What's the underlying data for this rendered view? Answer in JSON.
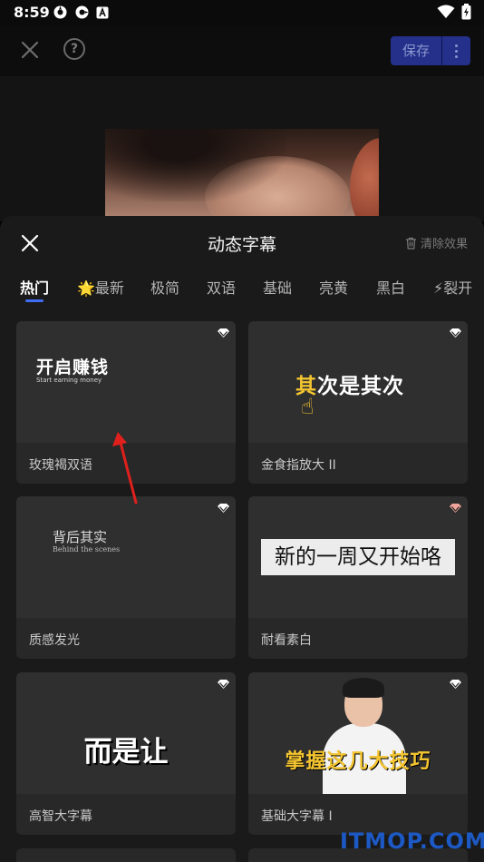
{
  "status": {
    "time": "8:59"
  },
  "topbar": {
    "save_label": "保存"
  },
  "sheet": {
    "title": "动态字幕",
    "clear_label": "清除效果",
    "tabs": [
      "热门",
      "🌟最新",
      "极简",
      "双语",
      "基础",
      "亮黄",
      "黑白",
      "⚡裂开"
    ]
  },
  "cards": [
    {
      "name": "玫瑰褐双语",
      "preview_cn": "开启赚钱",
      "preview_en": "Start earning money",
      "gem_color": "#ffffff"
    },
    {
      "name": "金食指放大 II",
      "preview_highlight": "其",
      "preview_rest": "次是其次",
      "gem_color": "#ffffff"
    },
    {
      "name": "质感发光",
      "preview_cn": "背后其实",
      "preview_en": "Behind the scenes",
      "gem_color": "#ffffff"
    },
    {
      "name": "耐看素白",
      "preview": "新的一周又开始咯",
      "gem_color": "#f0a69a"
    },
    {
      "name": "高智大字幕",
      "preview": "而是让",
      "gem_color": "#ffffff"
    },
    {
      "name": "基础大字幕 I",
      "preview": "掌握这几大技巧",
      "gem_color": "#ffffff"
    }
  ],
  "watermark": "ITMOP.COM"
}
